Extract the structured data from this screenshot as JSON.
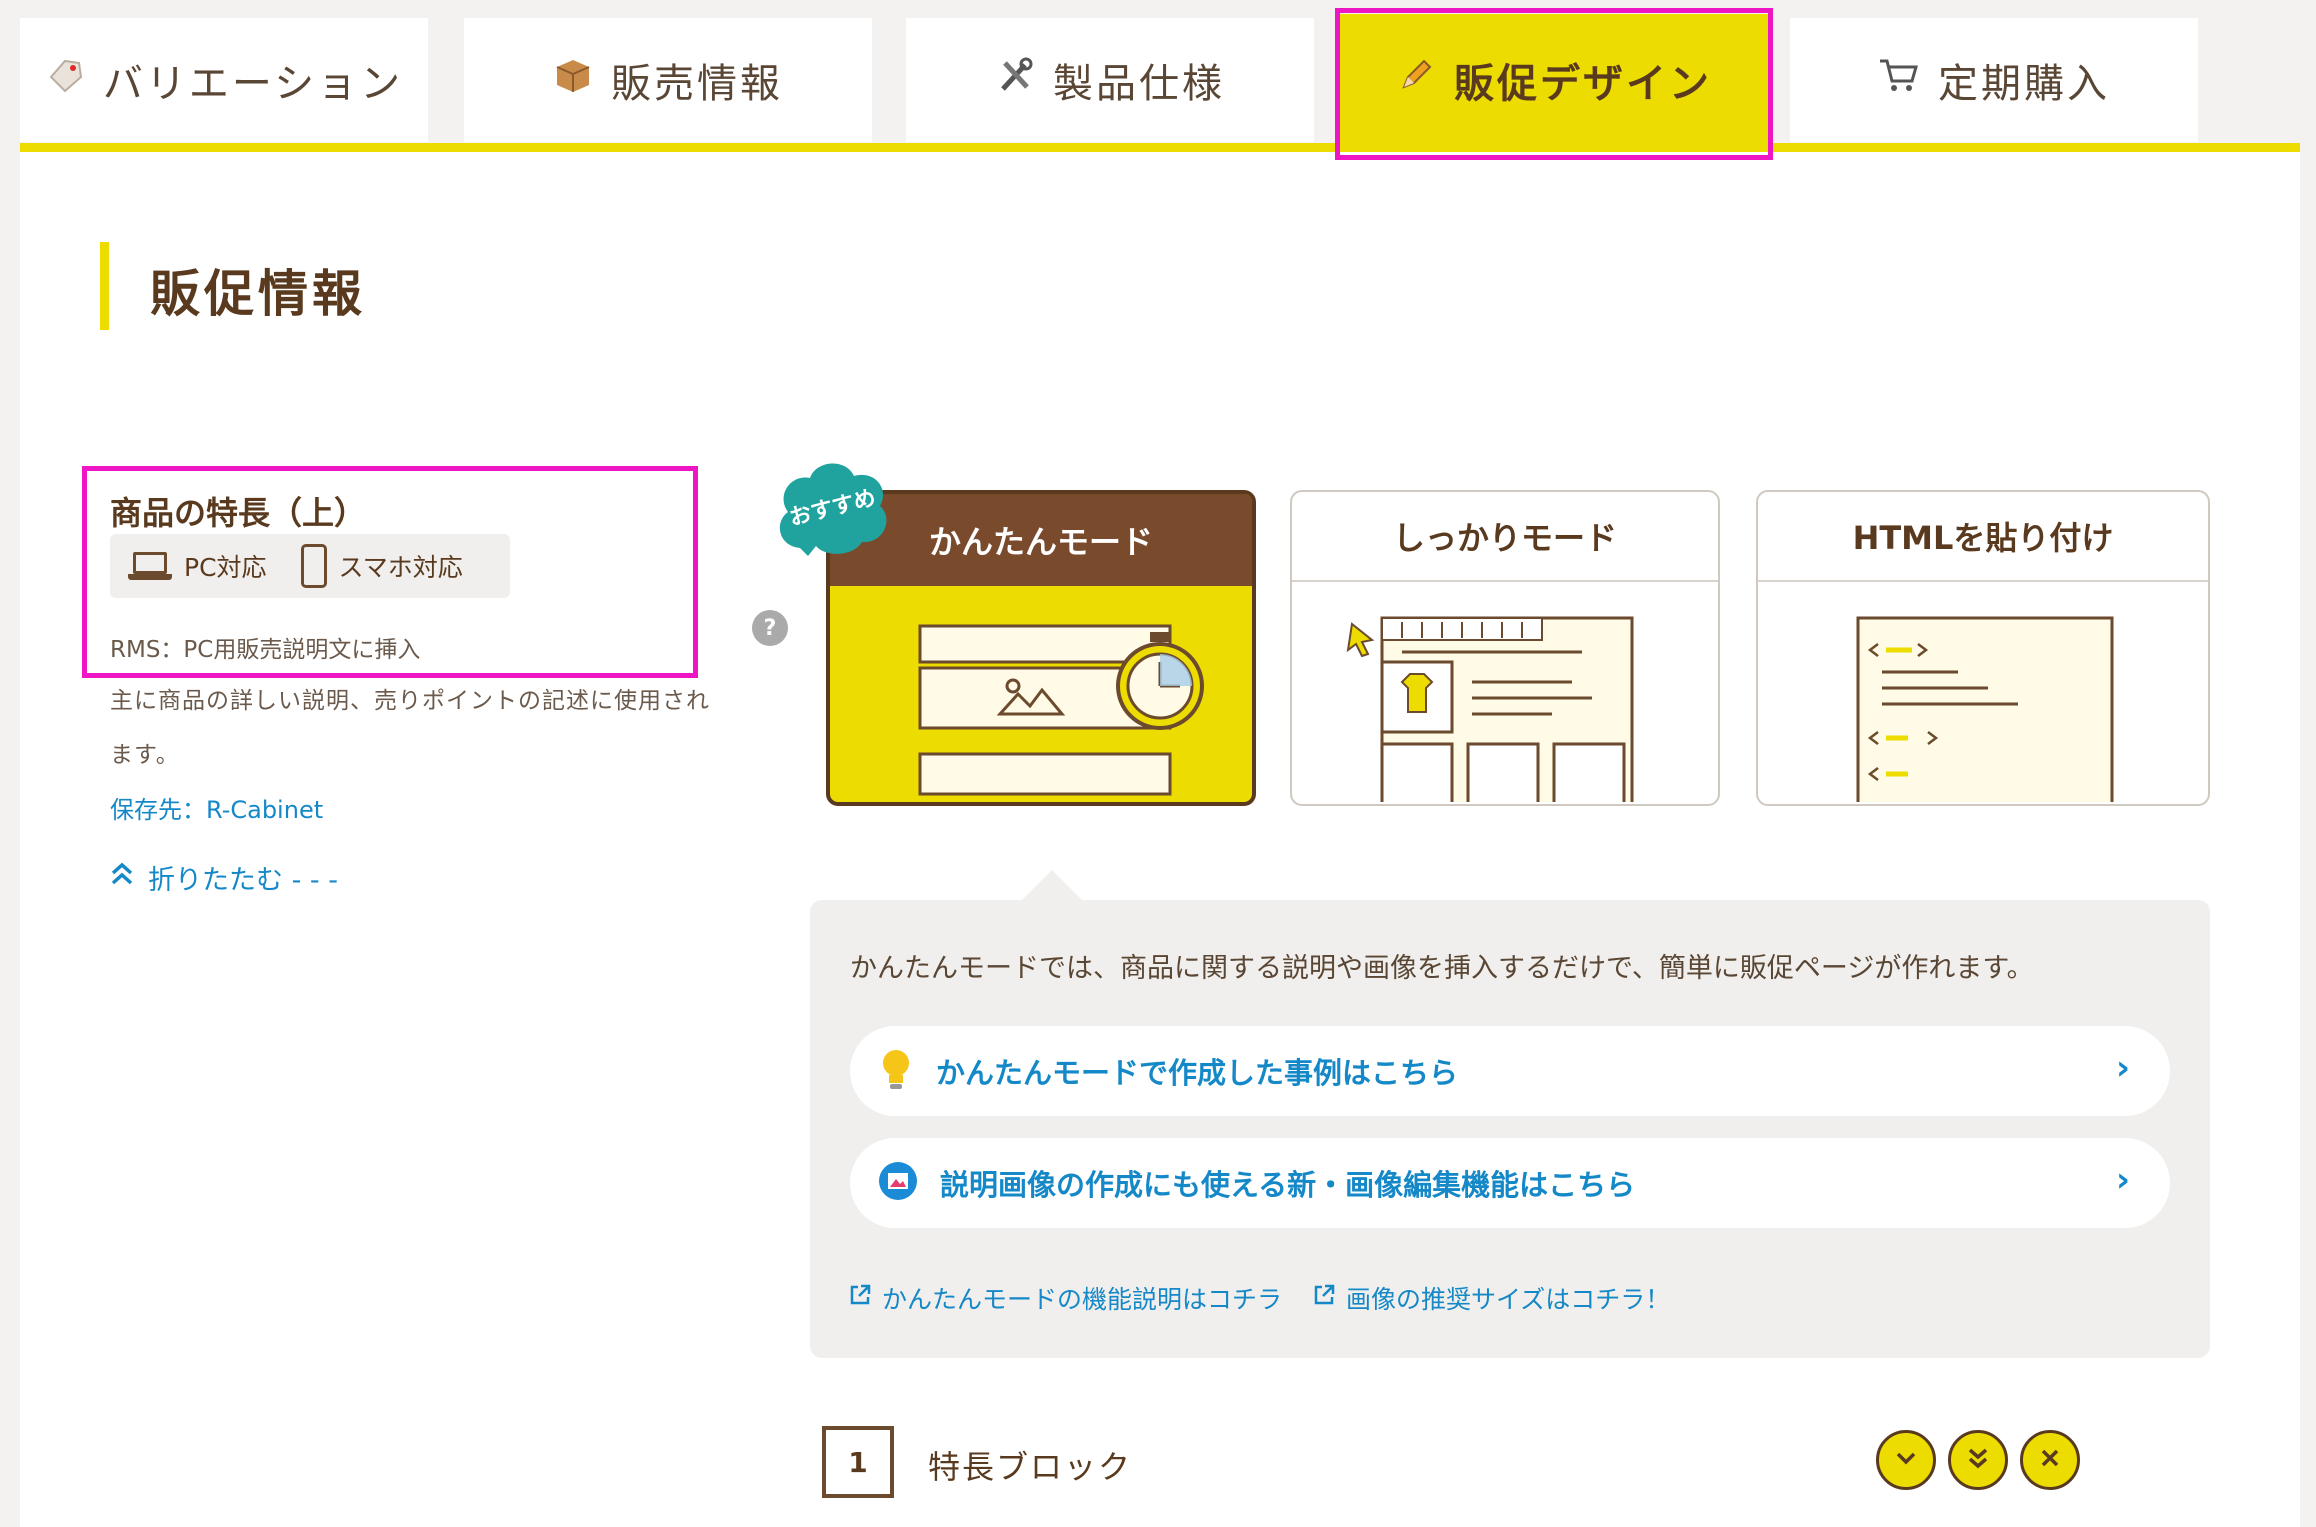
{
  "tabs": [
    {
      "label": "バリエーション",
      "icon": "tag-icon"
    },
    {
      "label": "販売情報",
      "icon": "package-icon"
    },
    {
      "label": "製品仕様",
      "icon": "tools-icon"
    },
    {
      "label": "販促デザイン",
      "icon": "pencil-icon",
      "active": true
    },
    {
      "label": "定期購入",
      "icon": "cart-icon"
    }
  ],
  "section": {
    "title": "販促情報"
  },
  "feature": {
    "title": "商品の特長（上）",
    "pc_label": "PC対応",
    "sp_label": "スマホ対応",
    "rms": "RMS：PC用販売説明文に挿入",
    "description": "主に商品の詳しい説明、売りポイントの記述に使用されます。",
    "save_to": "保存先：R-Cabinet",
    "fold_label": "折りたたむ - - -"
  },
  "help": {
    "mark": "?"
  },
  "modes": {
    "badge": "おすすめ",
    "easy": "かんたんモード",
    "full": "しっかりモード",
    "html": "HTMLを貼り付け"
  },
  "info": {
    "text": "かんたんモードでは、商品に関する説明や画像を挿入するだけで、簡単に販促ページが作れます。",
    "link1": "かんたんモードで作成した事例はこちら",
    "link2": "説明画像の作成にも使える新・画像編集機能はこちら",
    "bottom_link1": "かんたんモードの機能説明はコチラ",
    "bottom_link2": "画像の推奨サイズはコチラ！"
  },
  "block": {
    "number": "1",
    "label": "特長ブロック"
  },
  "colors": {
    "accent": "#ecdc00",
    "brown": "#5a3a1e",
    "link": "#1588c8",
    "highlight": "#ee16c4"
  }
}
